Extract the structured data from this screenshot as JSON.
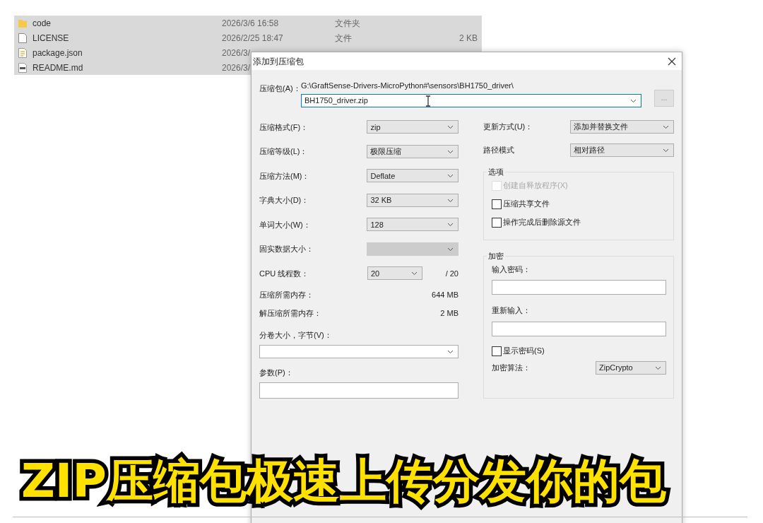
{
  "file_list": [
    {
      "kind": "folder",
      "name": "code",
      "date": "2026/3/6 16:58",
      "type": "文件夹",
      "selected": true
    },
    {
      "kind": "file",
      "name": "LICENSE",
      "date": "2026/2/25 18:47",
      "type": "文件",
      "size": "2 KB",
      "selected": true
    },
    {
      "kind": "text",
      "name": "package.json",
      "date": "2026/3/",
      "selected": true
    },
    {
      "kind": "markdown",
      "name": "README.md",
      "date": "2026/3/",
      "selected": true
    }
  ],
  "dialog": {
    "title": "添加到压缩包",
    "archive": {
      "label": "压缩包(A)：",
      "path": "G:\\GraftSense-Drivers-MicroPython#\\sensors\\BH1750_driver\\",
      "value": "BH1750_driver.zip",
      "browse": "..."
    },
    "left_fields": [
      {
        "kind": "combo",
        "label": "压缩格式(F)：",
        "value": "zip",
        "disabled": false
      },
      {
        "kind": "combo",
        "label": "压缩等级(L)：",
        "value": "极限压缩",
        "disabled": false
      },
      {
        "kind": "combo",
        "label": "压缩方法(M)：",
        "value": "Deflate",
        "disabled": false
      },
      {
        "kind": "combo",
        "label": "字典大小(D)：",
        "value": "32 KB",
        "disabled": false
      },
      {
        "kind": "combo",
        "label": "单词大小(W)：",
        "value": "128",
        "disabled": false
      },
      {
        "kind": "combo",
        "label": "固实数据大小：",
        "disabled": true
      },
      {
        "kind": "threads",
        "label": "CPU 线程数：",
        "value": "20",
        "max": "/ 20"
      },
      {
        "kind": "info",
        "label": "压缩所需内存：",
        "value": "644 MB"
      },
      {
        "kind": "info",
        "label": "解压缩所需内存：",
        "value": "2 MB"
      }
    ],
    "volume": {
      "label": "分卷大小，字节(V)："
    },
    "params": {
      "label": "参数(P)："
    },
    "right_fields": [
      {
        "label": "更新方式(U)：",
        "value": "添加并替换文件"
      },
      {
        "label": "路径模式",
        "value": "相对路径"
      }
    ],
    "options": {
      "title": "选项",
      "items": [
        {
          "label": "创建自释放程序(X)",
          "checked": false,
          "disabled": true
        },
        {
          "label": "压缩共享文件",
          "checked": false,
          "disabled": false
        },
        {
          "label": "操作完成后删除源文件",
          "checked": false,
          "disabled": false
        }
      ]
    },
    "encryption": {
      "title": "加密",
      "password_label": "输入密码：",
      "reenter_label": "重新输入：",
      "show_password": {
        "label": "显示密码(S)",
        "checked": false,
        "disabled": false
      },
      "method": {
        "label": "加密算法：",
        "value": "ZipCrypto"
      }
    }
  },
  "caption": "ZIP压缩包极速上传分发你的包"
}
